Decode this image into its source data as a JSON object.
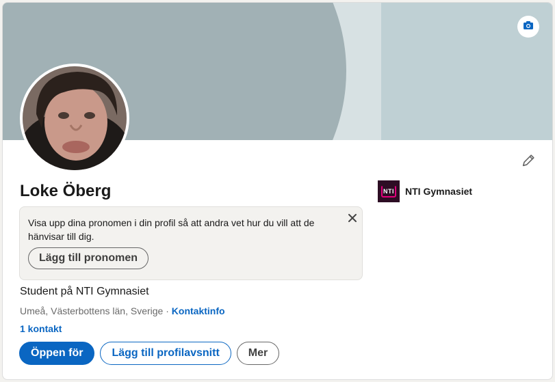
{
  "profile": {
    "name": "Loke Öberg",
    "headline": "Student på NTI Gymnasiet",
    "location": "Umeå, Västerbottens län, Sverige",
    "location_separator": " · ",
    "contact_info_label": "Kontaktinfo",
    "connections_label": "1 kontakt"
  },
  "organization": {
    "logo_text": "NTI",
    "name": "NTI Gymnasiet"
  },
  "pronoun_prompt": {
    "text": "Visa upp dina pronomen i din profil så att andra vet hur du vill att de hänvisar till dig.",
    "button_label": "Lägg till pronomen"
  },
  "actions": {
    "open_to_label": "Öppen för",
    "add_section_label": "Lägg till profilavsnitt",
    "more_label": "Mer"
  },
  "icons": {
    "banner_edit": "camera-icon",
    "intro_edit": "pencil-icon",
    "dismiss": "close-icon"
  },
  "colors": {
    "accent": "#0a66c2",
    "banner_light": "#bfd0d4",
    "banner_dark": "#a1b1b5",
    "logo_bg": "#2d0d24",
    "logo_accent": "#e4007c"
  }
}
